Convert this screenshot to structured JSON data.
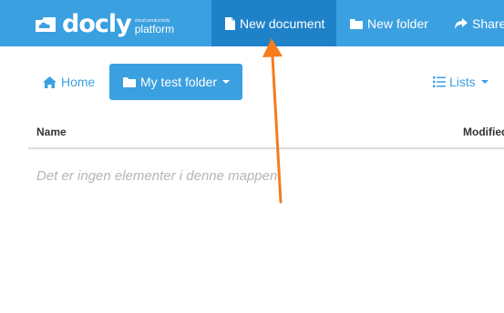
{
  "logo": {
    "name": "docly",
    "tagline": "cloud productivity",
    "platform": "platform"
  },
  "nav": {
    "new_document": "New document",
    "new_folder": "New folder",
    "share": "Share"
  },
  "toolbar": {
    "home": "Home",
    "folder": "My test folder",
    "lists": "Lists"
  },
  "table": {
    "columns": [
      "Name",
      "Modified"
    ],
    "empty_message": "Det er ingen elementer i denne mappen"
  },
  "colors": {
    "topbar": "#3ba0e0",
    "active_nav": "#1f82c9",
    "accent": "#3ba0e0",
    "annotation_arrow": "#f57c1f"
  },
  "icons": {
    "logo": "cloud-folder-icon",
    "new_document": "file-icon",
    "new_folder": "folder-icon",
    "share": "share-arrow-icon",
    "home": "home-icon",
    "folder_button": "folder-icon",
    "lists": "list-icon"
  }
}
